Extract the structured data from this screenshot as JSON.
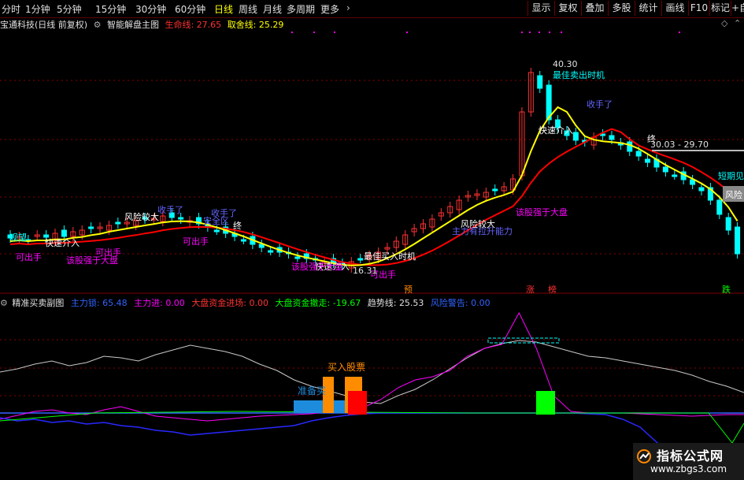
{
  "toolbar": {
    "periods": [
      "分时",
      "1分钟",
      "5分钟",
      "15分钟",
      "30分钟",
      "60分钟",
      "日线",
      "周线",
      "月线",
      "多周期",
      "更多"
    ],
    "active_period": "日线",
    "right_buttons": [
      "显示",
      "复权",
      "叠加",
      "多股",
      "统计",
      "画线",
      "F10",
      "标记",
      "+自"
    ]
  },
  "main_header": {
    "stock": "宝通科技(日线 前复权)",
    "indicator": "智能解盘主图",
    "life_label": "生命线:",
    "life_value": "27.65",
    "lead_label": "取舍线:",
    "lead_value": "25.29"
  },
  "sub_header": {
    "indicator": "精准买卖副图",
    "main_lock_label": "主力锁:",
    "main_lock_value": "65.48",
    "main_in_label": "主力进:",
    "main_in_value": "0.00",
    "big_in_label": "大盘资金进场:",
    "big_in_value": "0.00",
    "big_out_label": "大盘资金撤走:",
    "big_out_value": "-19.67",
    "trend_label": "趋势线:",
    "trend_value": "25.53",
    "warn_label": "风险警告:",
    "warn_value": "0.00"
  },
  "price_labels": {
    "high": "40.30",
    "low": "16.31",
    "range": "30.03 - 29.70"
  },
  "annotations": {
    "sell_hand": "可出手",
    "risk_big": "风险较大",
    "fast_buy": "快速介入",
    "stop_profit": "收手了",
    "strong_stock": "该股强于大盘",
    "zone": "安全区",
    "end": "终",
    "best_sell": "最佳卖出时机",
    "best_buy": "最佳买入时机",
    "main_power": "主力有拉升能力",
    "watch": "观望",
    "ready": "准备买",
    "buy_stock": "买入股票",
    "pre": "预",
    "rise": "涨",
    "bang": "榜",
    "fall": "跌",
    "risk_short": "风险",
    "short_stop": "短期见顶"
  },
  "colors": {
    "up": "#ff3232",
    "down": "#00ffff",
    "life_line": "#ff0000",
    "lead_line": "#ffff00",
    "magenta": "#ff00ff",
    "grid": "#8b0000"
  },
  "watermark": {
    "title": "指标公式网",
    "url": "www.zbgs3.com"
  }
}
